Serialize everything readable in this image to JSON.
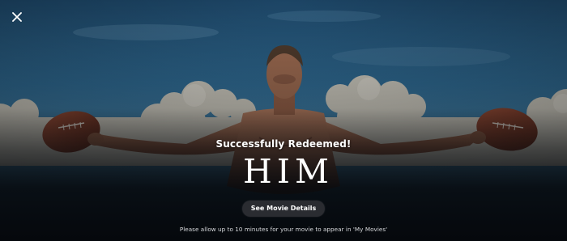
{
  "colors": {
    "sky_top": "#1f4a6b",
    "sky_mid": "#3f7aa0",
    "overlay": "#05080c",
    "button_bg": "#2a2c31",
    "text": "#ffffff"
  },
  "close": {
    "icon": "close-icon"
  },
  "hero": {
    "image": "movie-poster-man-holding-footballs"
  },
  "redeem": {
    "status": "Successfully Redeemed!",
    "movie_title": "HIM",
    "details_button": "See Movie Details",
    "note": "Please allow up to 10 minutes for your movie to appear in 'My Movies'"
  }
}
